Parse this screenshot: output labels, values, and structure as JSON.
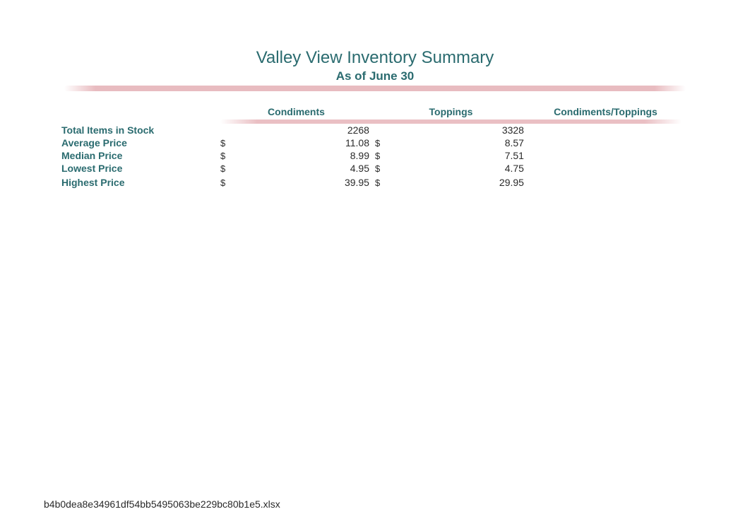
{
  "title": "Valley View Inventory Summary",
  "subtitle": "As of June 30",
  "columns": {
    "c1": "Condiments",
    "c2": "Toppings",
    "c3": "Condiments/Toppings"
  },
  "rows": {
    "total_items": {
      "label": "Total Items in Stock",
      "c1": "2268",
      "c2": "3328",
      "c3": ""
    },
    "average_price": {
      "label": "Average Price",
      "c1": "11.08",
      "c2": "8.57",
      "c3": ""
    },
    "median_price": {
      "label": "Median Price",
      "c1": "8.99",
      "c2": "7.51",
      "c3": ""
    },
    "lowest_price": {
      "label": "Lowest Price",
      "c1": "4.95",
      "c2": "4.75",
      "c3": ""
    },
    "highest_price": {
      "label": "Highest Price",
      "c1": "39.95",
      "c2": "29.95",
      "c3": ""
    }
  },
  "currency_symbol": "$",
  "footer": "b4b0dea8e34961df54bb5495063be229bc80b1e5.xlsx"
}
